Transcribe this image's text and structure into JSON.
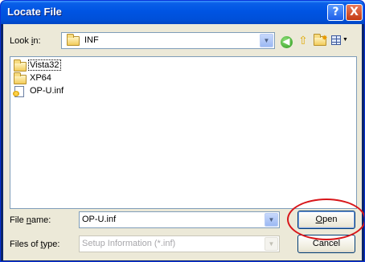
{
  "window": {
    "title": "Locate File",
    "help_icon": "?",
    "close_icon": "X"
  },
  "lookin": {
    "label": "Look in:",
    "value": "INF",
    "icon": "folder-icon"
  },
  "toolbar": {
    "back_icon": "back-icon",
    "up_icon": "up-folder-icon",
    "new_folder_icon": "new-folder-icon",
    "views_icon": "views-menu-icon"
  },
  "files": [
    {
      "name": "Vista32",
      "icon": "folder-icon"
    },
    {
      "name": "XP64",
      "icon": "folder-icon"
    },
    {
      "name": "OP-U.inf",
      "icon": "setup-file-icon"
    }
  ],
  "filename": {
    "label": "File name:",
    "value": "OP-U.inf"
  },
  "filetype": {
    "label": "Files of type:",
    "value": "Setup Information (*.inf)"
  },
  "buttons": {
    "open": "Open",
    "cancel": "Cancel"
  },
  "annotation": {
    "highlight_color": "#d8161a"
  }
}
